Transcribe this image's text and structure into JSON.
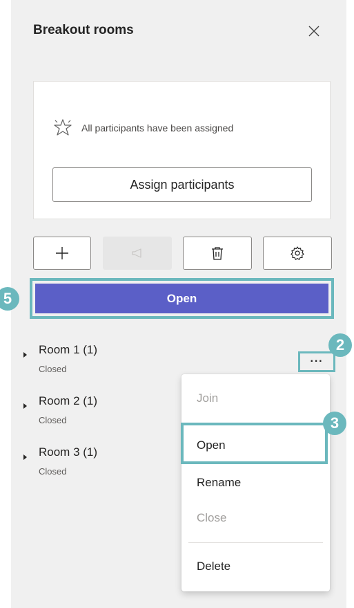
{
  "header": {
    "title": "Breakout rooms",
    "close_icon": "close-icon"
  },
  "assign_card": {
    "status_icon": "sparkle-icon",
    "status_text": "All participants have been assigned",
    "assign_button_label": "Assign participants"
  },
  "toolbar": {
    "buttons": [
      {
        "name": "add-room-button",
        "icon": "plus-icon",
        "enabled": true
      },
      {
        "name": "announce-button",
        "icon": "megaphone-icon",
        "enabled": false
      },
      {
        "name": "delete-room-button",
        "icon": "trash-icon",
        "enabled": true
      },
      {
        "name": "settings-button",
        "icon": "gear-icon",
        "enabled": true
      }
    ]
  },
  "open_all_button_label": "Open",
  "rooms": [
    {
      "name": "Room 1",
      "count": "(1)",
      "status": "Closed"
    },
    {
      "name": "Room 2",
      "count": "(1)",
      "status": "Closed"
    },
    {
      "name": "Room 3",
      "count": "(1)",
      "status": "Closed"
    }
  ],
  "more_options_label": "···",
  "context_menu": {
    "items": [
      {
        "label": "Join",
        "enabled": false
      },
      {
        "label": "Open",
        "enabled": true
      },
      {
        "label": "Rename",
        "enabled": true
      },
      {
        "label": "Close",
        "enabled": false
      },
      {
        "label": "Delete",
        "enabled": true
      }
    ]
  },
  "callouts": {
    "step_2": "2",
    "step_3": "3",
    "step_5": "5"
  },
  "colors": {
    "accent": "#5b5fc7",
    "callout": "#6bb8bd",
    "panel_bg": "#f0f0f0"
  }
}
